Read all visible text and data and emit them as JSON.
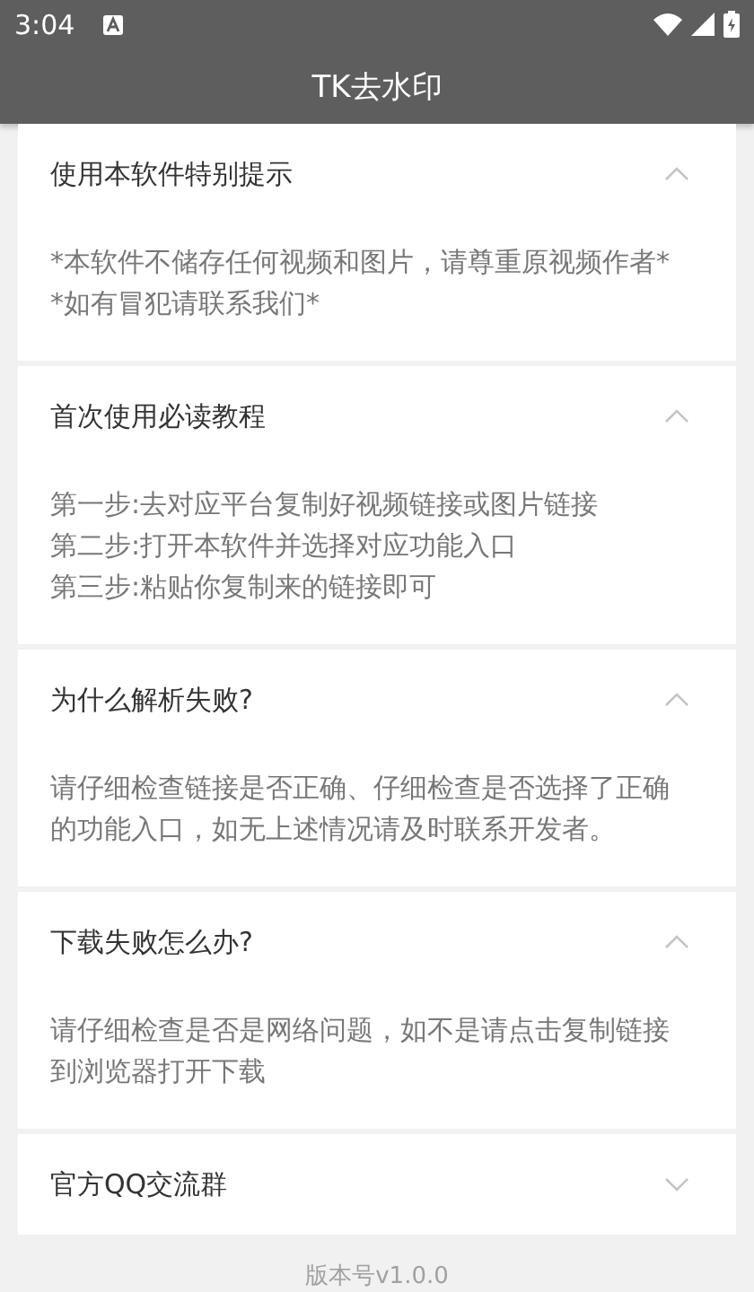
{
  "status_bar": {
    "time": "3:04"
  },
  "app_bar": {
    "title": "TK去水印"
  },
  "sections": [
    {
      "title": "使用本软件特别提示",
      "expanded": true,
      "body": [
        "*本软件不储存任何视频和图片，请尊重原视频作者*",
        "*如有冒犯请联系我们*"
      ]
    },
    {
      "title": "首次使用必读教程",
      "expanded": true,
      "body": [
        "第一步:去对应平台复制好视频链接或图片链接",
        "第二步:打开本软件并选择对应功能入口",
        "第三步:粘贴你复制来的链接即可"
      ]
    },
    {
      "title": "为什么解析失败?",
      "expanded": true,
      "body": [
        "请仔细检查链接是否正确、仔细检查是否选择了正确的功能入口，如无上述情况请及时联系开发者。"
      ]
    },
    {
      "title": "下载失败怎么办?",
      "expanded": true,
      "body": [
        "请仔细检查是否是网络问题，如不是请点击复制链接到浏览器打开下载"
      ]
    },
    {
      "title": "官方QQ交流群",
      "expanded": false
    }
  ],
  "footer": {
    "version": "版本号v1.0.0"
  }
}
